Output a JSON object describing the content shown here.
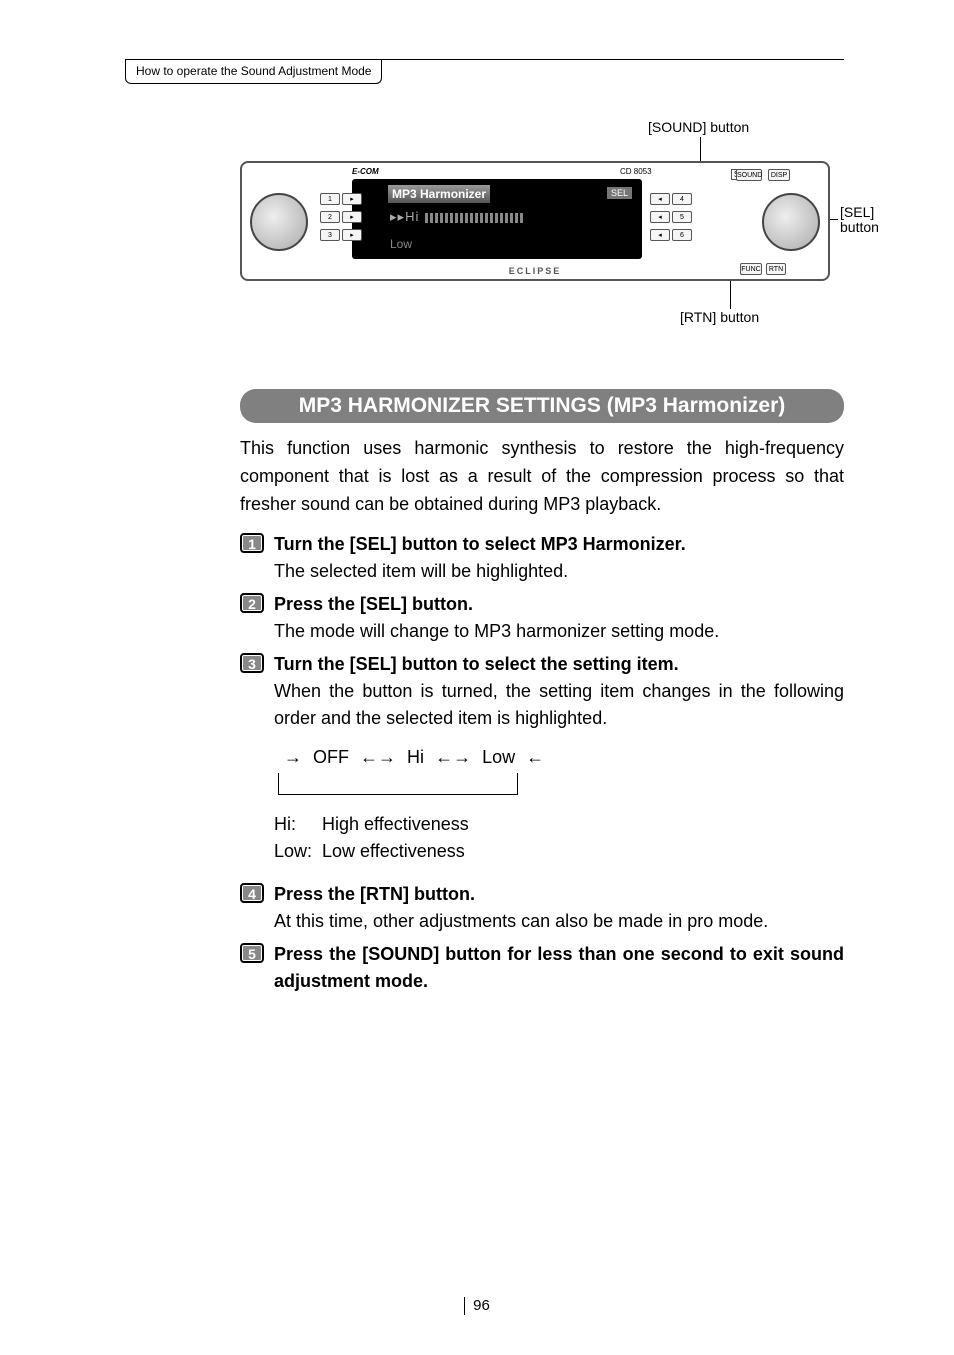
{
  "header": {
    "tab": "How to operate the Sound Adjustment Mode"
  },
  "labels": {
    "sound": "[SOUND] button",
    "sel": "[SEL]",
    "sel2": "button",
    "rtn": "[RTN] button"
  },
  "device": {
    "screenTitle": "MP3 Harmonizer",
    "screenSel": "SEL",
    "screenHi": "Hi",
    "screenLow": "Low",
    "eclipse": "ECLIPSE",
    "ecom": "E-COM",
    "model": "CD 8053",
    "sound": "SOUND",
    "disp": "DISP",
    "func": "FUNC",
    "rtn": "RTN",
    "sel": "SEL"
  },
  "section": {
    "title": "MP3 HARMONIZER SETTINGS (MP3 Harmonizer)"
  },
  "intro": "This function uses harmonic synthesis to restore the high-frequency component that is lost as a result of the compression process so that fresher sound can be obtained during MP3 playback.",
  "steps": [
    {
      "n": "1",
      "title": "Turn the [SEL] button to select MP3 Harmonizer.",
      "text": "The selected item will be highlighted."
    },
    {
      "n": "2",
      "title": "Press the [SEL] button.",
      "text": "The mode will change to MP3 harmonizer setting mode."
    },
    {
      "n": "3",
      "title": "Turn the [SEL] button to select the setting item.",
      "text": "When the button is turned, the setting item changes in the following order and the selected item is highlighted."
    },
    {
      "n": "4",
      "title": "Press the [RTN] button.",
      "text": "At this time, other adjustments can also be made in pro mode."
    },
    {
      "n": "5",
      "title": "Press the [SOUND] button for less than one second to exit sound adjustment mode.",
      "text": ""
    }
  ],
  "cycle": {
    "a": "OFF",
    "b": "Hi",
    "c": "Low"
  },
  "defs": {
    "hiKey": "Hi:",
    "hiVal": "High effectiveness",
    "lowKey": "Low:",
    "lowVal": "Low effectiveness"
  },
  "pageNumber": "96"
}
